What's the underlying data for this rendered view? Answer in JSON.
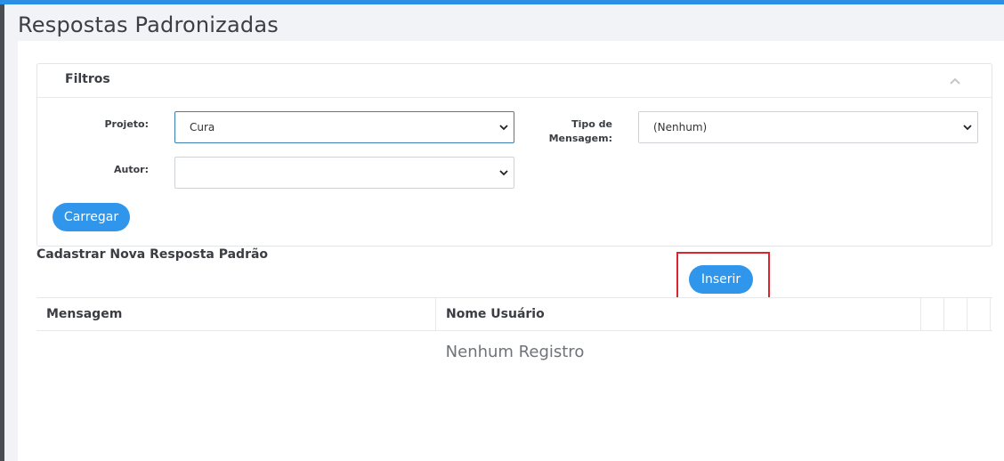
{
  "page": {
    "title": "Respostas Padronizadas"
  },
  "filters": {
    "title": "Filtros",
    "collapse_icon": "chevron-up-icon",
    "projeto_label": "Projeto:",
    "projeto_value": "Cura",
    "tipo_label_line1": "Tipo de",
    "tipo_label_line2": "Mensagem:",
    "tipo_value": "(Nenhum)",
    "autor_label": "Autor:",
    "autor_value": "",
    "carregar_label": "Carregar"
  },
  "create": {
    "title": "Cadastrar Nova Resposta Padrão",
    "inserir_label": "Inserir"
  },
  "table": {
    "columns": [
      "Mensagem",
      "Nome Usuário"
    ],
    "empty_message": "Nenhum Registro"
  },
  "colors": {
    "accent": "#2f96ec",
    "highlight": "#d9262c"
  }
}
